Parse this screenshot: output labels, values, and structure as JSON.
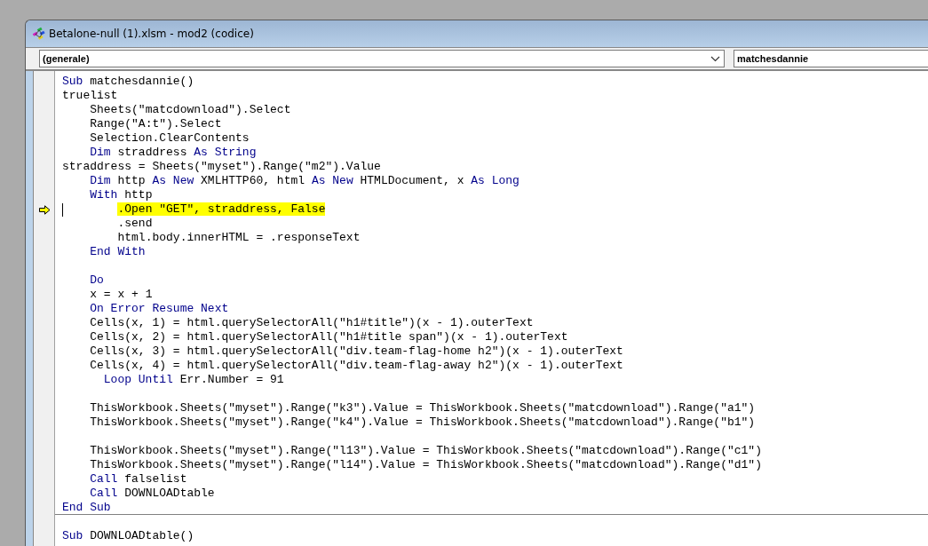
{
  "window": {
    "title": "Betalone-null (1).xlsm - mod2 (codice)"
  },
  "object_combo": {
    "value": "(generale)"
  },
  "procedure_combo": {
    "value": "matchesdannie"
  },
  "lines": [
    {
      "kind": "code",
      "tokens": [
        {
          "text": "Sub",
          "kind": "kw"
        },
        {
          "text": " matchesdannie()",
          "kind": "plain"
        }
      ]
    },
    {
      "kind": "code",
      "tokens": [
        {
          "text": "truelist",
          "kind": "plain"
        }
      ]
    },
    {
      "kind": "code",
      "tokens": [
        {
          "text": "    Sheets(\"matcdownload\").Select",
          "kind": "plain"
        }
      ]
    },
    {
      "kind": "code",
      "tokens": [
        {
          "text": "    Range(\"A:t\").Select",
          "kind": "plain"
        }
      ]
    },
    {
      "kind": "code",
      "tokens": [
        {
          "text": "    Selection.ClearContents",
          "kind": "plain"
        }
      ]
    },
    {
      "kind": "code",
      "tokens": [
        {
          "text": "    Dim",
          "kind": "kw"
        },
        {
          "text": " straddress ",
          "kind": "plain"
        },
        {
          "text": "As String",
          "kind": "kw"
        }
      ]
    },
    {
      "kind": "code",
      "tokens": [
        {
          "text": "straddress = Sheets(\"myset\").Range(\"m2\").Value",
          "kind": "plain"
        }
      ]
    },
    {
      "kind": "code",
      "tokens": [
        {
          "text": "    Dim",
          "kind": "kw"
        },
        {
          "text": " http ",
          "kind": "plain"
        },
        {
          "text": "As New",
          "kind": "kw"
        },
        {
          "text": " XMLHTTP60, html ",
          "kind": "plain"
        },
        {
          "text": "As New",
          "kind": "kw"
        },
        {
          "text": " HTMLDocument, x ",
          "kind": "plain"
        },
        {
          "text": "As Long",
          "kind": "kw"
        }
      ]
    },
    {
      "kind": "code",
      "tokens": [
        {
          "text": "    With",
          "kind": "kw"
        },
        {
          "text": " http",
          "kind": "plain"
        }
      ]
    },
    {
      "kind": "code",
      "highlighted": true,
      "current": true,
      "cursor": true,
      "tokens": [
        {
          "text": "        .Open \"GET\", straddress, False",
          "kind": "plain"
        }
      ]
    },
    {
      "kind": "code",
      "tokens": [
        {
          "text": "        .send",
          "kind": "plain"
        }
      ]
    },
    {
      "kind": "code",
      "tokens": [
        {
          "text": "        html.body.innerHTML = .responseText",
          "kind": "plain"
        }
      ]
    },
    {
      "kind": "code",
      "tokens": [
        {
          "text": "    End With",
          "kind": "kw"
        }
      ]
    },
    {
      "kind": "blank"
    },
    {
      "kind": "code",
      "tokens": [
        {
          "text": "    Do",
          "kind": "kw"
        }
      ]
    },
    {
      "kind": "code",
      "tokens": [
        {
          "text": "    x = x + 1",
          "kind": "plain"
        }
      ]
    },
    {
      "kind": "code",
      "tokens": [
        {
          "text": "    On Error Resume Next",
          "kind": "kw"
        }
      ]
    },
    {
      "kind": "code",
      "tokens": [
        {
          "text": "    Cells(x, 1) = html.querySelectorAll(\"h1#title\")(x - 1).outerText",
          "kind": "plain"
        }
      ]
    },
    {
      "kind": "code",
      "tokens": [
        {
          "text": "    Cells(x, 2) = html.querySelectorAll(\"h1#title span\")(x - 1).outerText",
          "kind": "plain"
        }
      ]
    },
    {
      "kind": "code",
      "tokens": [
        {
          "text": "    Cells(x, 3) = html.querySelectorAll(\"div.team-flag-home h2\")(x - 1).outerText",
          "kind": "plain"
        }
      ]
    },
    {
      "kind": "code",
      "tokens": [
        {
          "text": "    Cells(x, 4) = html.querySelectorAll(\"div.team-flag-away h2\")(x - 1).outerText",
          "kind": "plain"
        }
      ]
    },
    {
      "kind": "code",
      "tokens": [
        {
          "text": "      Loop Until",
          "kind": "kw"
        },
        {
          "text": " Err.Number = 91",
          "kind": "plain"
        }
      ]
    },
    {
      "kind": "blank"
    },
    {
      "kind": "code",
      "tokens": [
        {
          "text": "    ThisWorkbook.Sheets(\"myset\").Range(\"k3\").Value = ThisWorkbook.Sheets(\"matcdownload\").Range(\"a1\")",
          "kind": "plain"
        }
      ]
    },
    {
      "kind": "code",
      "tokens": [
        {
          "text": "    ThisWorkbook.Sheets(\"myset\").Range(\"k4\").Value = ThisWorkbook.Sheets(\"matcdownload\").Range(\"b1\")",
          "kind": "plain"
        }
      ]
    },
    {
      "kind": "blank"
    },
    {
      "kind": "code",
      "tokens": [
        {
          "text": "    ThisWorkbook.Sheets(\"myset\").Range(\"l13\").Value = ThisWorkbook.Sheets(\"matcdownload\").Range(\"c1\")",
          "kind": "plain"
        }
      ]
    },
    {
      "kind": "code",
      "tokens": [
        {
          "text": "    ThisWorkbook.Sheets(\"myset\").Range(\"l14\").Value = ThisWorkbook.Sheets(\"matcdownload\").Range(\"d1\")",
          "kind": "plain"
        }
      ]
    },
    {
      "kind": "code",
      "tokens": [
        {
          "text": "    Call",
          "kind": "kw"
        },
        {
          "text": " falselist",
          "kind": "plain"
        }
      ]
    },
    {
      "kind": "code",
      "tokens": [
        {
          "text": "    Call",
          "kind": "kw"
        },
        {
          "text": " DOWNLOADtable",
          "kind": "plain"
        }
      ]
    },
    {
      "kind": "code",
      "tokens": [
        {
          "text": "End Sub",
          "kind": "kw"
        }
      ]
    },
    {
      "kind": "divider"
    },
    {
      "kind": "blank"
    },
    {
      "kind": "code",
      "tokens": [
        {
          "text": "Sub",
          "kind": "kw"
        },
        {
          "text": " DOWNLOADtable()",
          "kind": "plain"
        }
      ]
    }
  ]
}
